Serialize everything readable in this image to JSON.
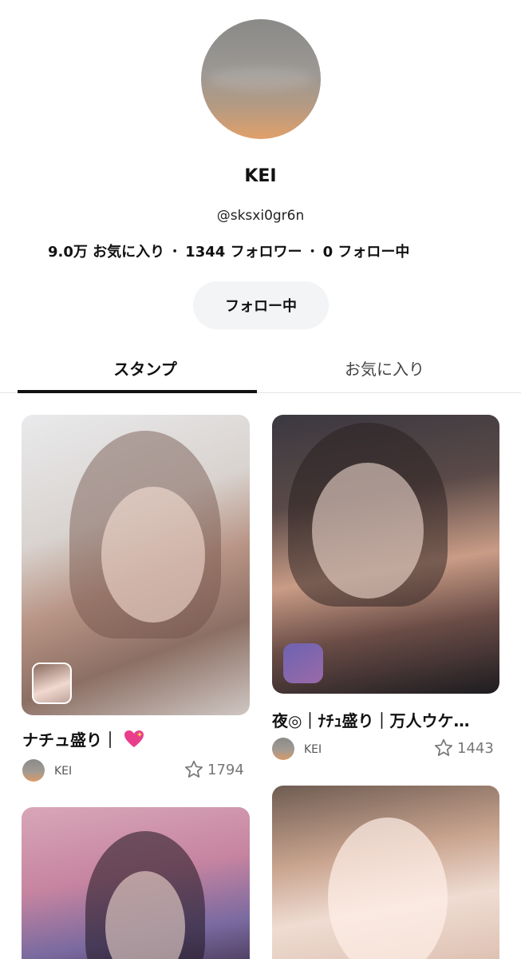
{
  "profile": {
    "display_name": "KEI",
    "handle": "@sksxi0gr6n",
    "stats": {
      "favorites_count": "9.0万",
      "favorites_label": "お気に入り",
      "followers_count": "1344",
      "followers_label": "フォロワー",
      "following_count": "0",
      "following_label": "フォロー中",
      "separator": "・"
    },
    "follow_button_label": "フォロー中"
  },
  "tabs": [
    {
      "label": "スタンプ",
      "active": true
    },
    {
      "label": "お気に入り",
      "active": false
    }
  ],
  "stickers": [
    {
      "title": "ナチュ盛り｜",
      "emoji": "sparkling-heart",
      "author": "KEI",
      "likes": "1794"
    },
    {
      "title": "夜◎｜ﾅﾁｭ盛り｜万人ウケ…",
      "author": "KEI",
      "likes": "1443"
    }
  ],
  "colors": {
    "accent": "#111111",
    "tab_indicator": "#111111",
    "button_bg": "#f3f4f6",
    "heart": "#e83e8c"
  }
}
